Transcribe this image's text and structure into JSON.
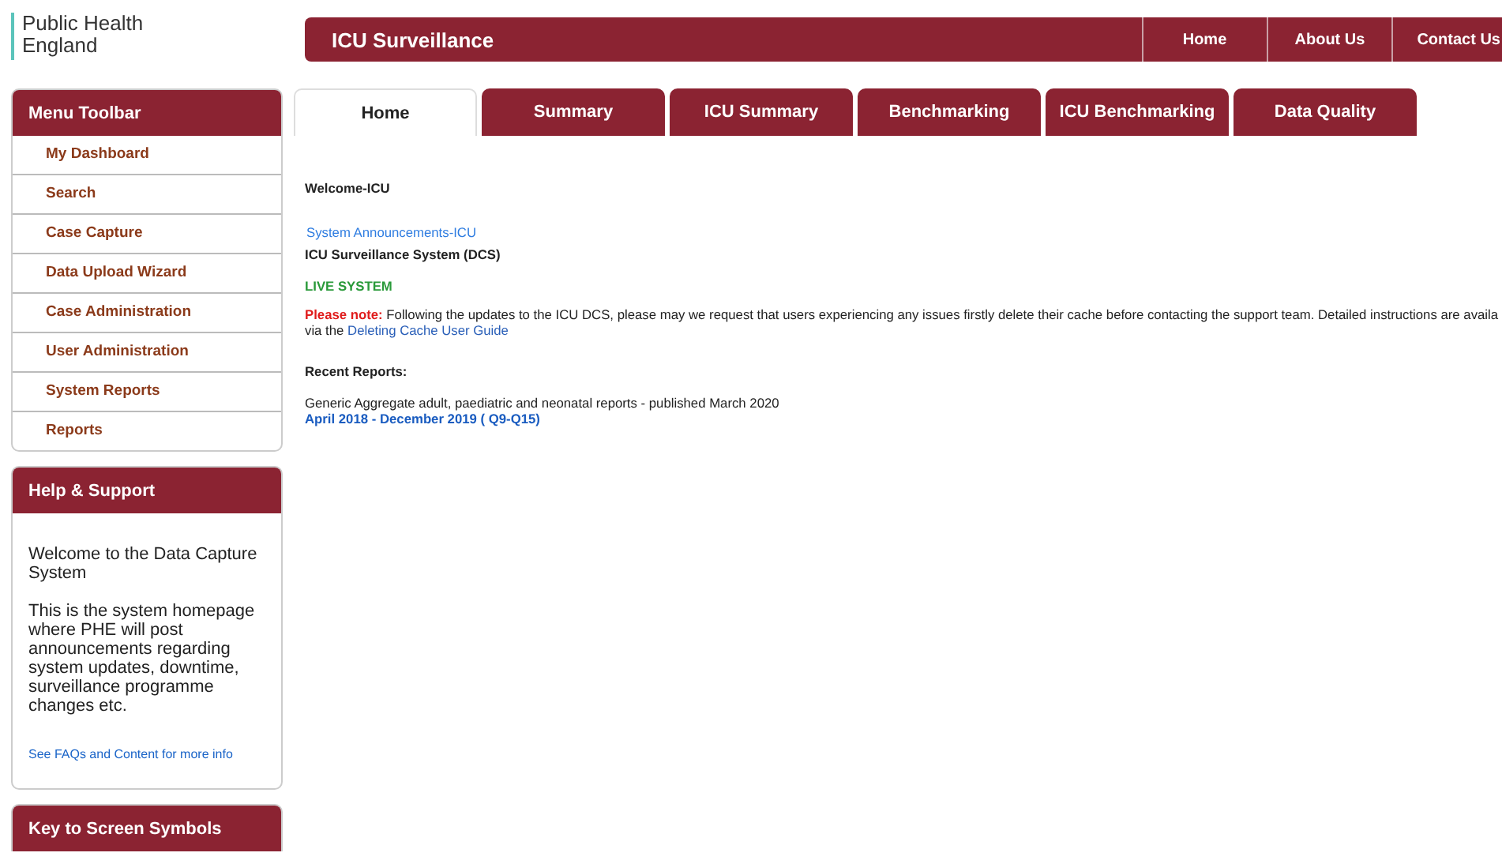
{
  "logo": {
    "line1": "Public Health",
    "line2": "England"
  },
  "header": {
    "title": "ICU Surveillance",
    "links": [
      "Home",
      "About Us",
      "Contact Us"
    ]
  },
  "menu": {
    "title": "Menu Toolbar",
    "items": [
      "My Dashboard",
      "Search",
      "Case Capture",
      "Data Upload Wizard",
      "Case Administration",
      "User Administration",
      "System Reports",
      "Reports"
    ]
  },
  "help": {
    "title": "Help & Support",
    "paragraphs": [
      "Welcome to the Data Capture System",
      "This is the system homepage where PHE will post announcements regarding system updates, downtime, surveillance programme changes etc."
    ],
    "link": "See FAQs and Content for more info"
  },
  "key_panel": {
    "title": "Key to Screen Symbols"
  },
  "tabs": [
    {
      "label": "Home",
      "selected": true
    },
    {
      "label": "Summary",
      "selected": false
    },
    {
      "label": "ICU Summary",
      "selected": false
    },
    {
      "label": "Benchmarking",
      "selected": false
    },
    {
      "label": "ICU Benchmarking",
      "selected": false
    },
    {
      "label": "Data Quality",
      "selected": false
    }
  ],
  "content": {
    "welcome": "Welcome-ICU",
    "announcements_link": "System Announcements-ICU",
    "system_name": "ICU Surveillance System (DCS)",
    "status": "LIVE SYSTEM",
    "notice": {
      "prefix": "Please note:",
      "text": "Following the updates to the ICU DCS, please may we request that users experiencing any issues firstly delete their cache before contacting the support team. Detailed instructions are availa",
      "via": "via the",
      "link": "Deleting Cache User Guide"
    },
    "recent_title": "Recent Reports:",
    "report_text": "Generic Aggregate adult, paediatric and neonatal reports - published March 2020",
    "report_link": "April 2018 - December 2019 ( Q9-Q15)"
  }
}
